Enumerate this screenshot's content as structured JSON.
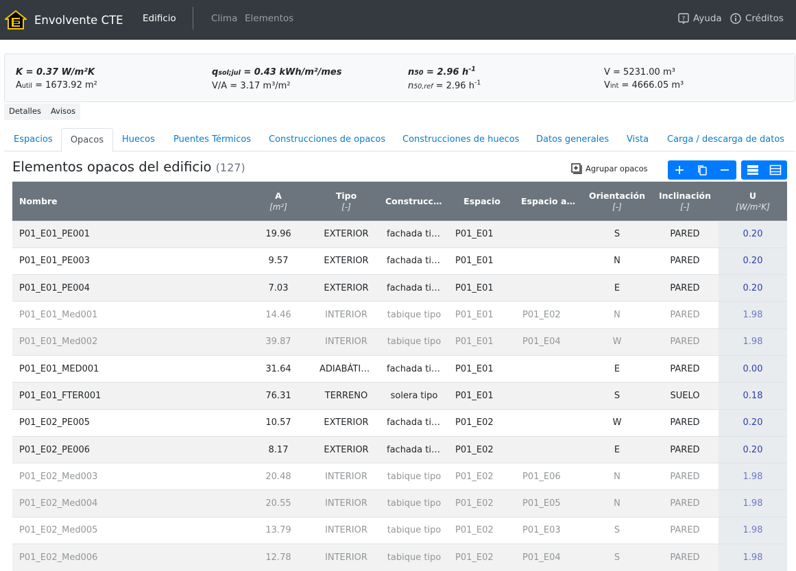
{
  "app": {
    "title": "Envolvente CTE",
    "nav": {
      "active": "Edificio",
      "clima": "Clima",
      "elementos": "Elementos"
    },
    "right": {
      "ayuda": "Ayuda",
      "creditos": "Créditos"
    }
  },
  "summary": {
    "k": "K = 0.37 W/m²K",
    "autil_label": "A",
    "autil_sub": "util",
    "autil_value": " = 1673.92 m²",
    "qsol_label": "q",
    "qsol_sub": "sol;jul",
    "qsol_value": " = 0.43 kWh/m²/mes",
    "va": "V/A = 3.17 m³/m²",
    "n50_label": "n",
    "n50_sub": "50",
    "n50_value": " = 2.96 h",
    "n50_sup": "-1",
    "n50ref_label": "n",
    "n50ref_sub": "50,ref",
    "n50ref_value": " = 2.96 h",
    "n50ref_sup": "-1",
    "v": "V = 5231.00 m³",
    "vint_label": "V",
    "vint_sub": "int",
    "vint_value": " = 4666.05 m³"
  },
  "minitabs": [
    "Detalles",
    "Avisos"
  ],
  "tabs": [
    "Espacios",
    "Opacos",
    "Huecos",
    "Puentes Térmicos",
    "Construcciones de opacos",
    "Construcciones de huecos",
    "Datos generales",
    "Vista",
    "Carga / descarga de datos"
  ],
  "section": {
    "title": "Elementos opacos del edificio",
    "count": "(127)",
    "group_label": "Agrupar opacos"
  },
  "table": {
    "headers": {
      "nombre": "Nombre",
      "a": "A",
      "a_unit": "[m²]",
      "tipo": "Tipo",
      "tipo_unit": "[-]",
      "construccion": "Construcción",
      "espacio": "Espacio",
      "espacio_ady": "Espacio adyacente",
      "orientacion": "Orientación",
      "orientacion_unit": "[-]",
      "inclinacion": "Inclinación",
      "inclinacion_unit": "[-]",
      "u": "U",
      "u_unit": "[W/m²K]"
    },
    "rows": [
      {
        "nombre": "P01_E01_PE001",
        "a": "19.96",
        "tipo": "EXTERIOR",
        "construccion": "fachada tipo",
        "espacio": "P01_E01",
        "ady": "",
        "orient": "S",
        "incl": "PARED",
        "u": "0.20",
        "muted": false
      },
      {
        "nombre": "P01_E01_PE003",
        "a": "9.57",
        "tipo": "EXTERIOR",
        "construccion": "fachada tipo",
        "espacio": "P01_E01",
        "ady": "",
        "orient": "N",
        "incl": "PARED",
        "u": "0.20",
        "muted": false
      },
      {
        "nombre": "P01_E01_PE004",
        "a": "7.03",
        "tipo": "EXTERIOR",
        "construccion": "fachada tipo",
        "espacio": "P01_E01",
        "ady": "",
        "orient": "E",
        "incl": "PARED",
        "u": "0.20",
        "muted": false
      },
      {
        "nombre": "P01_E01_Med001",
        "a": "14.46",
        "tipo": "INTERIOR",
        "construccion": "tabique tipo",
        "espacio": "P01_E01",
        "ady": "P01_E02",
        "orient": "N",
        "incl": "PARED",
        "u": "1.98",
        "muted": true
      },
      {
        "nombre": "P01_E01_Med002",
        "a": "39.87",
        "tipo": "INTERIOR",
        "construccion": "tabique tipo",
        "espacio": "P01_E01",
        "ady": "P01_E04",
        "orient": "W",
        "incl": "PARED",
        "u": "1.98",
        "muted": true
      },
      {
        "nombre": "P01_E01_MED001",
        "a": "31.64",
        "tipo": "ADIABÁTICO",
        "construccion": "fachada tipo",
        "espacio": "P01_E01",
        "ady": "",
        "orient": "E",
        "incl": "PARED",
        "u": "0.00",
        "muted": false
      },
      {
        "nombre": "P01_E01_FTER001",
        "a": "76.31",
        "tipo": "TERRENO",
        "construccion": "solera tipo",
        "espacio": "P01_E01",
        "ady": "",
        "orient": "S",
        "incl": "SUELO",
        "u": "0.18",
        "muted": false
      },
      {
        "nombre": "P01_E02_PE005",
        "a": "10.57",
        "tipo": "EXTERIOR",
        "construccion": "fachada tipo",
        "espacio": "P01_E02",
        "ady": "",
        "orient": "W",
        "incl": "PARED",
        "u": "0.20",
        "muted": false
      },
      {
        "nombre": "P01_E02_PE006",
        "a": "8.17",
        "tipo": "EXTERIOR",
        "construccion": "fachada tipo",
        "espacio": "P01_E02",
        "ady": "",
        "orient": "E",
        "incl": "PARED",
        "u": "0.20",
        "muted": false
      },
      {
        "nombre": "P01_E02_Med003",
        "a": "20.48",
        "tipo": "INTERIOR",
        "construccion": "tabique tipo",
        "espacio": "P01_E02",
        "ady": "P01_E06",
        "orient": "N",
        "incl": "PARED",
        "u": "1.98",
        "muted": true
      },
      {
        "nombre": "P01_E02_Med004",
        "a": "20.55",
        "tipo": "INTERIOR",
        "construccion": "tabique tipo",
        "espacio": "P01_E02",
        "ady": "P01_E05",
        "orient": "N",
        "incl": "PARED",
        "u": "1.98",
        "muted": true
      },
      {
        "nombre": "P01_E02_Med005",
        "a": "13.79",
        "tipo": "INTERIOR",
        "construccion": "tabique tipo",
        "espacio": "P01_E02",
        "ady": "P01_E03",
        "orient": "S",
        "incl": "PARED",
        "u": "1.98",
        "muted": true
      },
      {
        "nombre": "P01_E02_Med006",
        "a": "12.78",
        "tipo": "INTERIOR",
        "construccion": "tabique tipo",
        "espacio": "P01_E02",
        "ady": "P01_E04",
        "orient": "S",
        "incl": "PARED",
        "u": "1.98",
        "muted": true
      }
    ]
  }
}
